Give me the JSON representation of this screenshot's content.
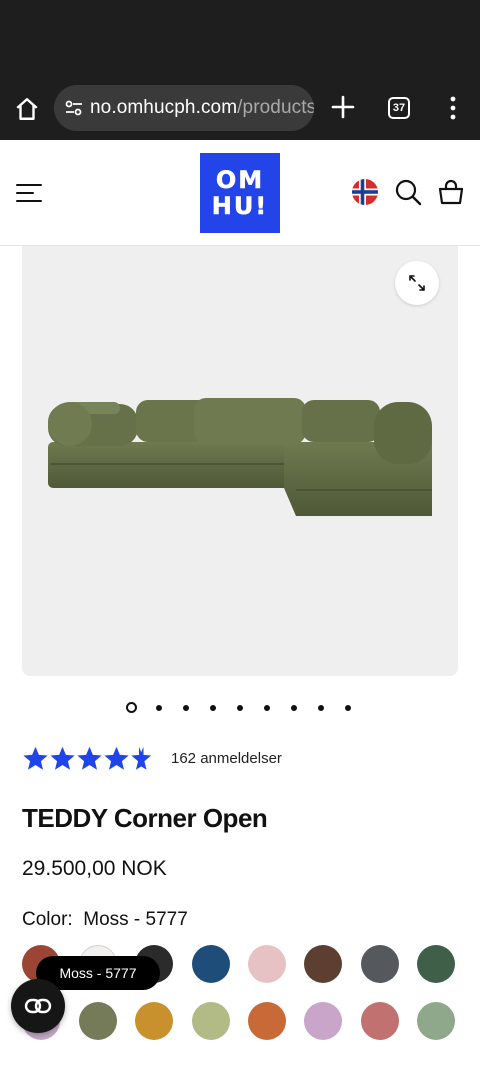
{
  "browser": {
    "url_domain": "no.omhucph.com",
    "url_path": "/products",
    "tab_count": "37"
  },
  "header": {
    "logo_line1": "OM",
    "logo_line2": "HU!",
    "brand_color": "#2244e8"
  },
  "gallery": {
    "slide_count": 9,
    "active_slide": 1
  },
  "product": {
    "rating": 4.5,
    "review_count_label": "162 anmeldelser",
    "title": "TEDDY Corner Open",
    "price": "29.500,00 NOK",
    "color_label": "Color:",
    "color_value": "Moss - 5777"
  },
  "swatches": [
    {
      "color": "#9b4634"
    },
    {
      "color": "#f2f0ee"
    },
    {
      "color": "#2b2b2b"
    },
    {
      "color": "#1e4d7a"
    },
    {
      "color": "#e6c2c4"
    },
    {
      "color": "#5c3f31"
    },
    {
      "color": "#55585d"
    },
    {
      "color": "#3f5f48"
    },
    {
      "color": "#c7aac9"
    },
    {
      "color": "#757a58"
    },
    {
      "color": "#c8912e"
    },
    {
      "color": "#b2ba86"
    },
    {
      "color": "#c86a37"
    },
    {
      "color": "#c9a6c9"
    },
    {
      "color": "#c07170"
    },
    {
      "color": "#8fa88b"
    }
  ],
  "tooltip": {
    "text": "Moss - 5777"
  },
  "colors": {
    "star": "#1f44ea",
    "browser_bg": "#1e1e1e"
  }
}
